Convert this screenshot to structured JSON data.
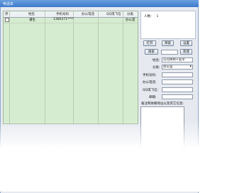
{
  "window": {
    "title": "电话本"
  },
  "grid": {
    "headers": [
      "序",
      "姓名",
      "手机号码",
      "办公电话",
      "QQ或飞信",
      "分类"
    ],
    "rows": [
      {
        "index": "1",
        "name": "潘生",
        "mobile": "1380371****",
        "office": "",
        "qq": "",
        "category": "办公室"
      }
    ]
  },
  "panel": {
    "count_label": "人数：",
    "count_value": "1",
    "buttons": {
      "open": "打开",
      "save": "简链",
      "settings": "设置",
      "search": "搜索",
      "new": "新建"
    },
    "search_value": "",
    "fields": {
      "name_label": "姓名:",
      "name_value": "公司简称+名字",
      "category_label": "分类:",
      "category_value": "办公室",
      "mobile_label": "手机号码:",
      "office_label": "办公电话:",
      "qq_label": "QQ或飞信:",
      "email_label": "邮箱:",
      "notes_label": "备注和依赖地址以及其它信息:"
    }
  }
}
